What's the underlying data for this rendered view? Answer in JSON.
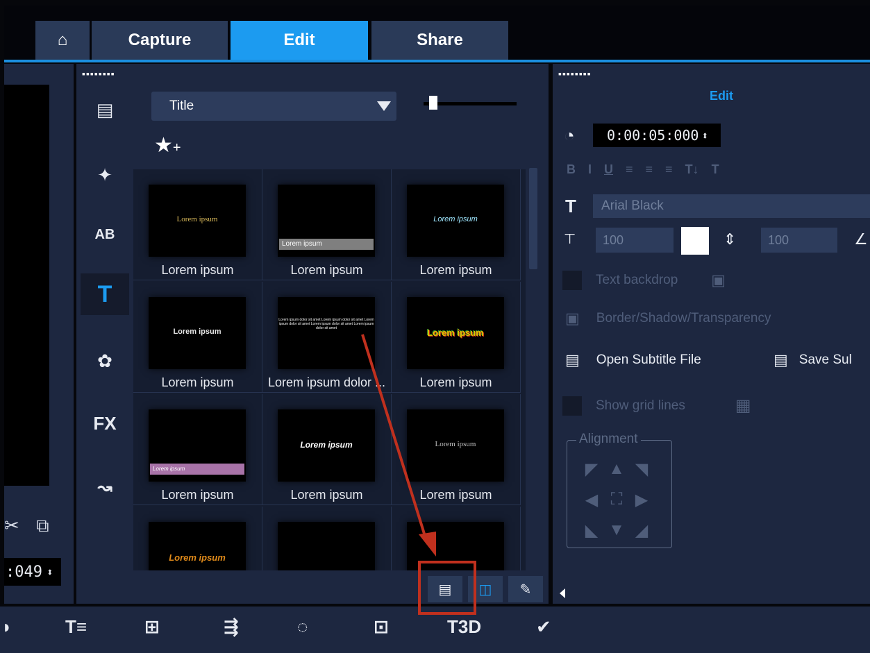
{
  "tabs": {
    "home_icon": "home-icon",
    "capture": "Capture",
    "edit": "Edit",
    "share": "Share"
  },
  "preview": {
    "timecode": ":049"
  },
  "library": {
    "category": "Title",
    "items": [
      {
        "caption": "Lorem ipsum",
        "sample": "Lorem ipsum",
        "style": "gold"
      },
      {
        "caption": "Lorem ipsum",
        "sample": "Lorem ipsum",
        "style": "bar-grey"
      },
      {
        "caption": "Lorem ipsum",
        "sample": "Lorem ipsum",
        "style": "italic-cyan"
      },
      {
        "caption": "Lorem ipsum",
        "sample": "Lorem ipsum",
        "style": "white-small"
      },
      {
        "caption": "Lorem ipsum dolor ...",
        "sample": "Lorem ipsum dolor sit amet",
        "style": "multiline"
      },
      {
        "caption": "Lorem ipsum",
        "sample": "Lorem ipsum",
        "style": "colorful"
      },
      {
        "caption": "Lorem ipsum",
        "sample": "Lorem ipsum",
        "style": "bar-purple"
      },
      {
        "caption": "Lorem ipsum",
        "sample": "Lorem ipsum",
        "style": "bold-italic"
      },
      {
        "caption": "Lorem ipsum",
        "sample": "Lorem ipsum",
        "style": "serif"
      },
      {
        "caption": "",
        "sample": "Lorem ipsum",
        "style": "orange"
      },
      {
        "caption": "",
        "sample": "",
        "style": "empty"
      },
      {
        "caption": "",
        "sample": "",
        "style": "empty"
      }
    ]
  },
  "options": {
    "header": "Edit",
    "duration": "0:00:05:000",
    "font_name": "Arial Black",
    "font_size": "100",
    "line_spacing": "100",
    "text_backdrop": "Text backdrop",
    "border_shadow": "Border/Shadow/Transparency",
    "open_subtitle": "Open Subtitle File",
    "save_subtitle": "Save Sul",
    "show_grid": "Show grid lines",
    "alignment": "Alignment",
    "format_buttons": [
      "B",
      "I",
      "U",
      "≡",
      "≡",
      "≡",
      "T↓",
      "T"
    ]
  },
  "colors": {
    "accent": "#1c9bf0",
    "panel": "#1d2740",
    "highlight": "#c0301e"
  }
}
